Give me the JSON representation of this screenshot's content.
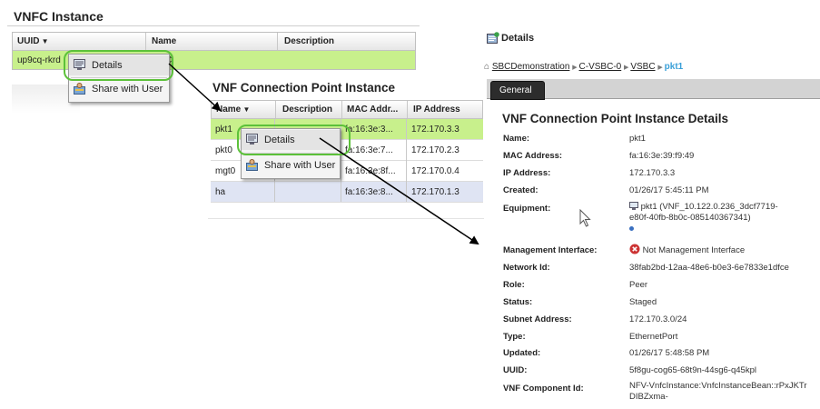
{
  "vnfc_panel": {
    "title": "VNFC Instance",
    "columns": [
      "UUID",
      "Name",
      "Description"
    ],
    "row": {
      "uuid": "up9cq-rkrd",
      "description_partial": "C"
    },
    "menu": {
      "details": "Details",
      "share": "Share with User"
    }
  },
  "cp_panel": {
    "title": "VNF Connection Point Instance",
    "columns": [
      "Name",
      "Description",
      "MAC Addr...",
      "IP Address"
    ],
    "rows": [
      {
        "name": "pkt1",
        "description": "",
        "mac": "fa:16:3e:3...",
        "ip": "172.170.3.3"
      },
      {
        "name": "pkt0",
        "description": "",
        "mac": "fa:16:3e:7...",
        "ip": "172.170.2.3"
      },
      {
        "name": "mgt0",
        "description": "",
        "mac": "fa:16:3e:8f...",
        "ip": "172.170.0.4"
      },
      {
        "name": "ha",
        "description": "",
        "mac": "fa:16:3e:8...",
        "ip": "172.170.1.3"
      }
    ],
    "menu": {
      "details": "Details",
      "share": "Share with User"
    }
  },
  "details_panel": {
    "title": "Details",
    "breadcrumb": [
      "SBCDemonstration",
      "C-VSBC-0",
      "VSBC",
      "pkt1"
    ],
    "tab": "General",
    "subtitle": "VNF Connection Point Instance Details",
    "fields": [
      {
        "label": "Name:",
        "value": "pkt1"
      },
      {
        "label": "MAC Address:",
        "value": "fa:16:3e:39:f9:49"
      },
      {
        "label": "IP Address:",
        "value": "172.170.3.3"
      },
      {
        "label": "Created:",
        "value": "01/26/17 5:45:11 PM"
      },
      {
        "label": "Equipment:",
        "value_line1": "pkt1 (VNF_10.122.0.236_3dcf7719-",
        "value_line2": "e80f-40fb-8b0c-085140367341)"
      },
      {
        "label": "Management Interface:",
        "value": "Not Management Interface"
      },
      {
        "label": "Network Id:",
        "value": "38fab2bd-12aa-48e6-b0e3-6e7833e1dfce"
      },
      {
        "label": "Role:",
        "value": "Peer"
      },
      {
        "label": "Status:",
        "value": "Staged"
      },
      {
        "label": "Subnet Address:",
        "value": "172.170.3.0/24"
      },
      {
        "label": "Type:",
        "value": "EthernetPort"
      },
      {
        "label": "Updated:",
        "value": "01/26/17 5:48:58 PM"
      },
      {
        "label": "UUID:",
        "value": "5f8gu-cog65-68t9n-44sg6-q45kpl"
      },
      {
        "label": "VNF Component Id:",
        "value_line1": "NFV-VnfcInstance:VnfcInstanceBean::rPxJKTr",
        "value_line2": "DIBZxma-"
      }
    ]
  },
  "colors": {
    "row_highlight": "#c8f08c",
    "callout_green": "#5cc13a",
    "breadcrumb_current": "#3aa0d8",
    "tab_dark": "#2c2c2c",
    "error_red": "#cc3333"
  }
}
